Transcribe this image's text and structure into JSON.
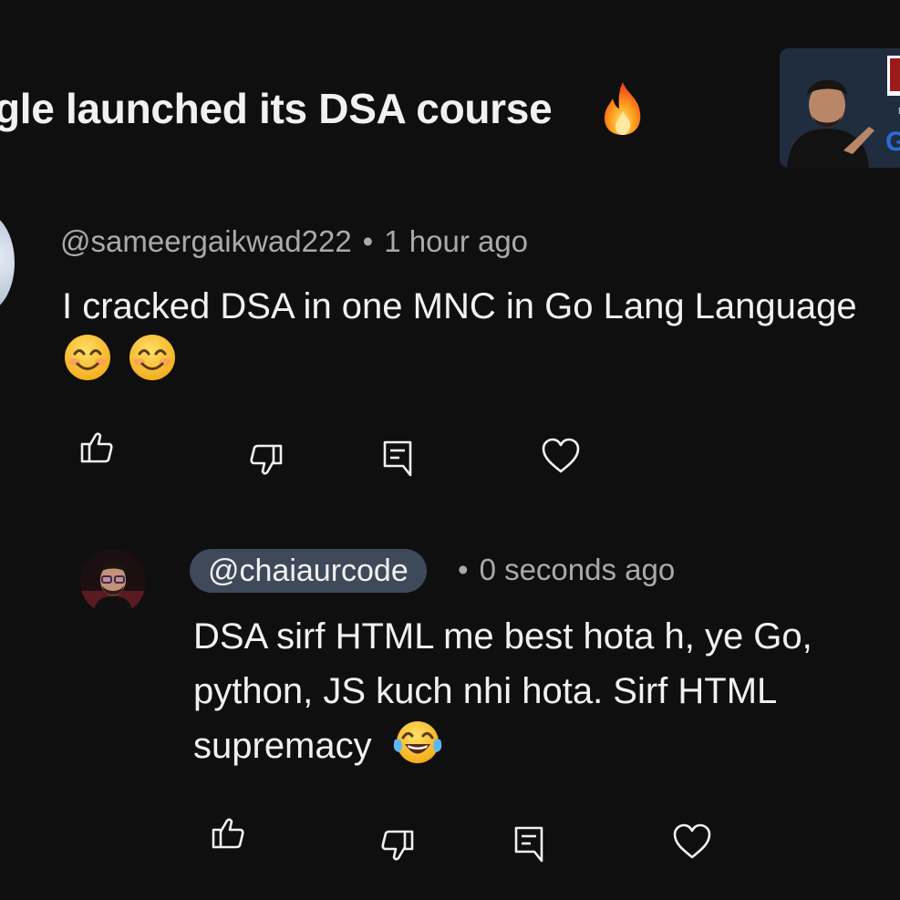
{
  "video": {
    "title": "gle launched its DSA course",
    "title_emoji": "fire-emoji"
  },
  "comment": {
    "author": "@sameergaikwad222",
    "separator": "•",
    "time": "1 hour ago",
    "text": "I cracked DSA in one MNC in Go Lang Language",
    "emojis": [
      "smiling-face-emoji",
      "smiling-face-emoji"
    ],
    "actions": [
      "like",
      "dislike",
      "reply",
      "heart"
    ]
  },
  "reply": {
    "author": "@chaiaurcode",
    "separator": "•",
    "time": "0 seconds ago",
    "text_lines": [
      "DSA sirf HTML me best hota h, ye Go,",
      "python, JS kuch nhi hota. Sirf HTML",
      "supremacy"
    ],
    "emoji": "tears-of-joy-emoji",
    "actions": [
      "like",
      "dislike",
      "reply",
      "heart"
    ]
  },
  "colors": {
    "background": "#0f0f0f",
    "text_primary": "#f1f1f1",
    "text_secondary": "#aaaaaa",
    "handle_chip": "#3e4a5a"
  }
}
